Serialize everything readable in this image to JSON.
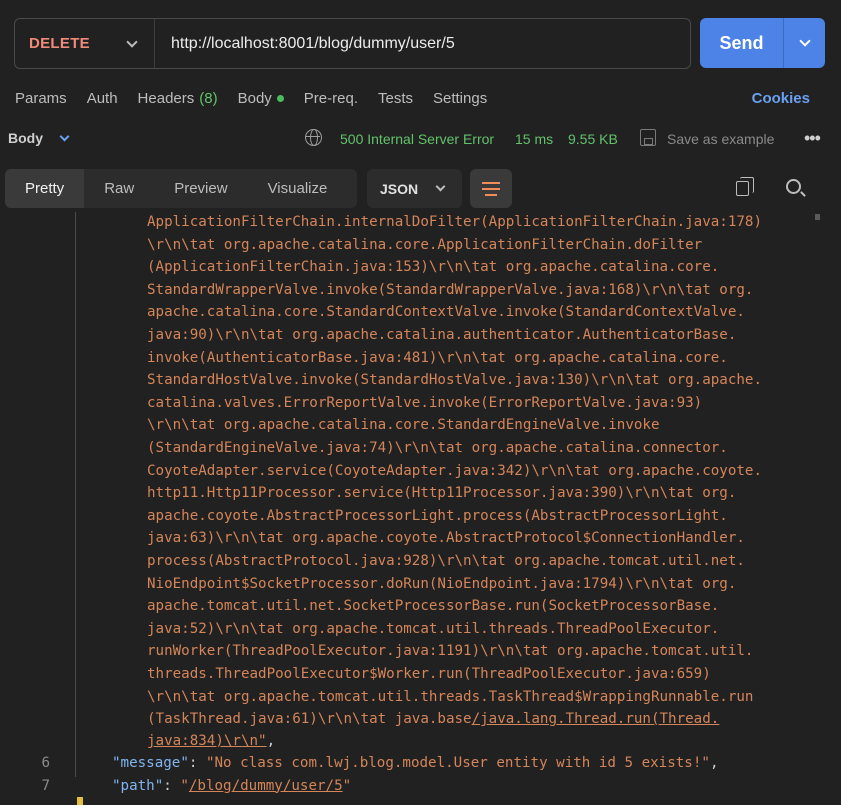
{
  "request": {
    "method": "DELETE",
    "url": "http://localhost:8001/blog/dummy/user/5",
    "send_label": "Send"
  },
  "request_tabs": {
    "params": "Params",
    "auth": "Auth",
    "headers": "Headers",
    "headers_count": "(8)",
    "body": "Body",
    "prereq": "Pre-req.",
    "tests": "Tests",
    "settings": "Settings",
    "cookies": "Cookies"
  },
  "response_meta": {
    "body_label": "Body",
    "status": "500 Internal Server Error",
    "time": "15 ms",
    "size": "9.55 KB",
    "save_example": "Save as example",
    "more": "•••"
  },
  "view_tabs": [
    "Pretty",
    "Raw",
    "Preview",
    "Visualize"
  ],
  "format": "JSON",
  "stack_lines": [
    "ApplicationFilterChain.internalDoFilter(ApplicationFilterChain.java:178)",
    "\\r\\n\\tat org.apache.catalina.core.ApplicationFilterChain.doFilter",
    "(ApplicationFilterChain.java:153)\\r\\n\\tat org.apache.catalina.core.",
    "StandardWrapperValve.invoke(StandardWrapperValve.java:168)\\r\\n\\tat org.",
    "apache.catalina.core.StandardContextValve.invoke(StandardContextValve.",
    "java:90)\\r\\n\\tat org.apache.catalina.authenticator.AuthenticatorBase.",
    "invoke(AuthenticatorBase.java:481)\\r\\n\\tat org.apache.catalina.core.",
    "StandardHostValve.invoke(StandardHostValve.java:130)\\r\\n\\tat org.apache.",
    "catalina.valves.ErrorReportValve.invoke(ErrorReportValve.java:93)",
    "\\r\\n\\tat org.apache.catalina.core.StandardEngineValve.invoke",
    "(StandardEngineValve.java:74)\\r\\n\\tat org.apache.catalina.connector.",
    "CoyoteAdapter.service(CoyoteAdapter.java:342)\\r\\n\\tat org.apache.coyote.",
    "http11.Http11Processor.service(Http11Processor.java:390)\\r\\n\\tat org.",
    "apache.coyote.AbstractProcessorLight.process(AbstractProcessorLight.",
    "java:63)\\r\\n\\tat org.apache.coyote.AbstractProtocol$ConnectionHandler.",
    "process(AbstractProtocol.java:928)\\r\\n\\tat org.apache.tomcat.util.net.",
    "NioEndpoint$SocketProcessor.doRun(NioEndpoint.java:1794)\\r\\n\\tat org.",
    "apache.tomcat.util.net.SocketProcessorBase.run(SocketProcessorBase.",
    "java:52)\\r\\n\\tat org.apache.tomcat.util.threads.ThreadPoolExecutor.",
    "runWorker(ThreadPoolExecutor.java:1191)\\r\\n\\tat org.apache.tomcat.util.",
    "threads.ThreadPoolExecutor$Worker.run(ThreadPoolExecutor.java:659)",
    "\\r\\n\\tat org.apache.tomcat.util.threads.TaskThread$WrappingRunnable.run",
    "(TaskThread.java:61)\\r\\n\\tat java.base/java.lang.Thread.run(Thread."
  ],
  "stack_last": {
    "text": "java:834)\\r\\n\"",
    "suffix": ","
  },
  "json_lines": [
    {
      "num": "6",
      "key": "\"message\"",
      "sep": ": ",
      "value": "\"No class com.lwj.blog.model.User entity with id 5 exists!\"",
      "end": ","
    },
    {
      "num": "7",
      "key": "\"path\"",
      "sep": ": ",
      "value": "\"/blog/dummy/user/5\"",
      "end": ""
    }
  ],
  "colors": {
    "accent": "#4d82e6",
    "method": "#f08b7a",
    "status_ok": "#62c26b",
    "string": "#d4855a",
    "key": "#80b5f0"
  }
}
